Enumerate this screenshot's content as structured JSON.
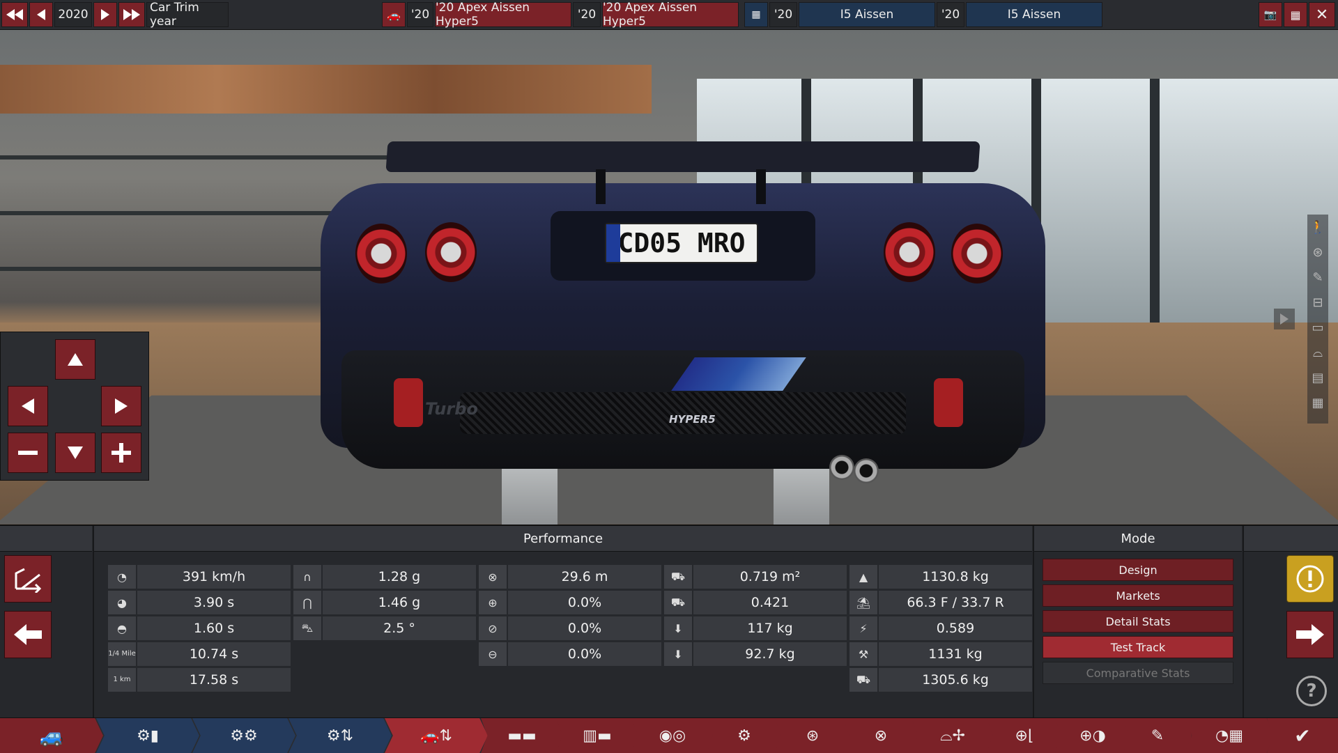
{
  "topbar": {
    "year": "2020",
    "trim_label": "Car Trim year",
    "model_year_1": "'20",
    "model_name_1": "'20 Apex Aissen Hyper5",
    "trim_year_1": "'20",
    "trim_name_1": "'20 Apex Aissen Hyper5",
    "engine_year_1": "'20",
    "engine_name_1": "I5 Aissen",
    "engine_year_2": "'20",
    "engine_name_2": "I5 Aissen",
    "close_label": "✕"
  },
  "scene": {
    "license_plate": "CD05 MRO",
    "car_badge_left": "Turbo",
    "car_badge_right": "HYPER5"
  },
  "performance": {
    "header": "Performance",
    "col1": [
      {
        "icon": "top-speed-icon",
        "value": "391 km/h"
      },
      {
        "icon": "accel-0-100-icon",
        "value": "3.90 s"
      },
      {
        "icon": "accel-60-100-icon",
        "value": "1.60 s"
      },
      {
        "icon": "quarter-mile-icon",
        "icon_text": "1/4 Mile",
        "value": "10.74 s"
      },
      {
        "icon": "one-km-icon",
        "icon_text": "1 km",
        "value": "17.58 s"
      }
    ],
    "col2": [
      {
        "icon": "grip-low-icon",
        "value": "1.28 g"
      },
      {
        "icon": "grip-high-icon",
        "value": "1.46 g"
      },
      {
        "icon": "roll-angle-icon",
        "value": "2.5 °"
      }
    ],
    "col3": [
      {
        "icon": "braking-distance-icon",
        "value": "29.6 m"
      },
      {
        "icon": "brake-fade-icon",
        "value": "0.0%"
      },
      {
        "icon": "wheel-lock-icon",
        "value": "0.0%"
      },
      {
        "icon": "understeer-icon",
        "value": "0.0%"
      }
    ],
    "col4": [
      {
        "icon": "frontal-area-icon",
        "value": "0.719 m²"
      },
      {
        "icon": "drag-coefficient-icon",
        "value": "0.421"
      },
      {
        "icon": "front-downforce-icon",
        "value": "117 kg"
      },
      {
        "icon": "rear-downforce-icon",
        "value": "92.7 kg"
      }
    ],
    "col5": [
      {
        "icon": "weight-icon",
        "value": "1130.8 kg"
      },
      {
        "icon": "weight-distribution-icon",
        "value": "66.3 F / 33.7 R"
      },
      {
        "icon": "lift-icon",
        "value": "0.589"
      },
      {
        "icon": "tow-weight-icon",
        "value": "1131 kg"
      },
      {
        "icon": "gross-weight-icon",
        "value": "1305.6 kg"
      }
    ]
  },
  "mode": {
    "header": "Mode",
    "items": [
      "Design",
      "Markets",
      "Detail Stats",
      "Test Track",
      "Comparative Stats"
    ],
    "active": "Test Track"
  },
  "colors": {
    "accent_red": "#7b2228",
    "active_red": "#a02b32",
    "nav_blue": "#243a5c",
    "warning_yellow": "#c9a020"
  },
  "nav": {
    "items": [
      "car-body-icon",
      "engine-parts-icon",
      "engine-block-icon",
      "engine-tune-icon",
      "car-trim-icon",
      "chassis-icon",
      "suspension-icon",
      "headlight-icon",
      "gearbox-icon",
      "wheels-icon",
      "brakes-icon",
      "aero-icon",
      "interior-icon",
      "tyres-icon",
      "paint-icon",
      "test-track-icon",
      "finish-icon"
    ]
  }
}
